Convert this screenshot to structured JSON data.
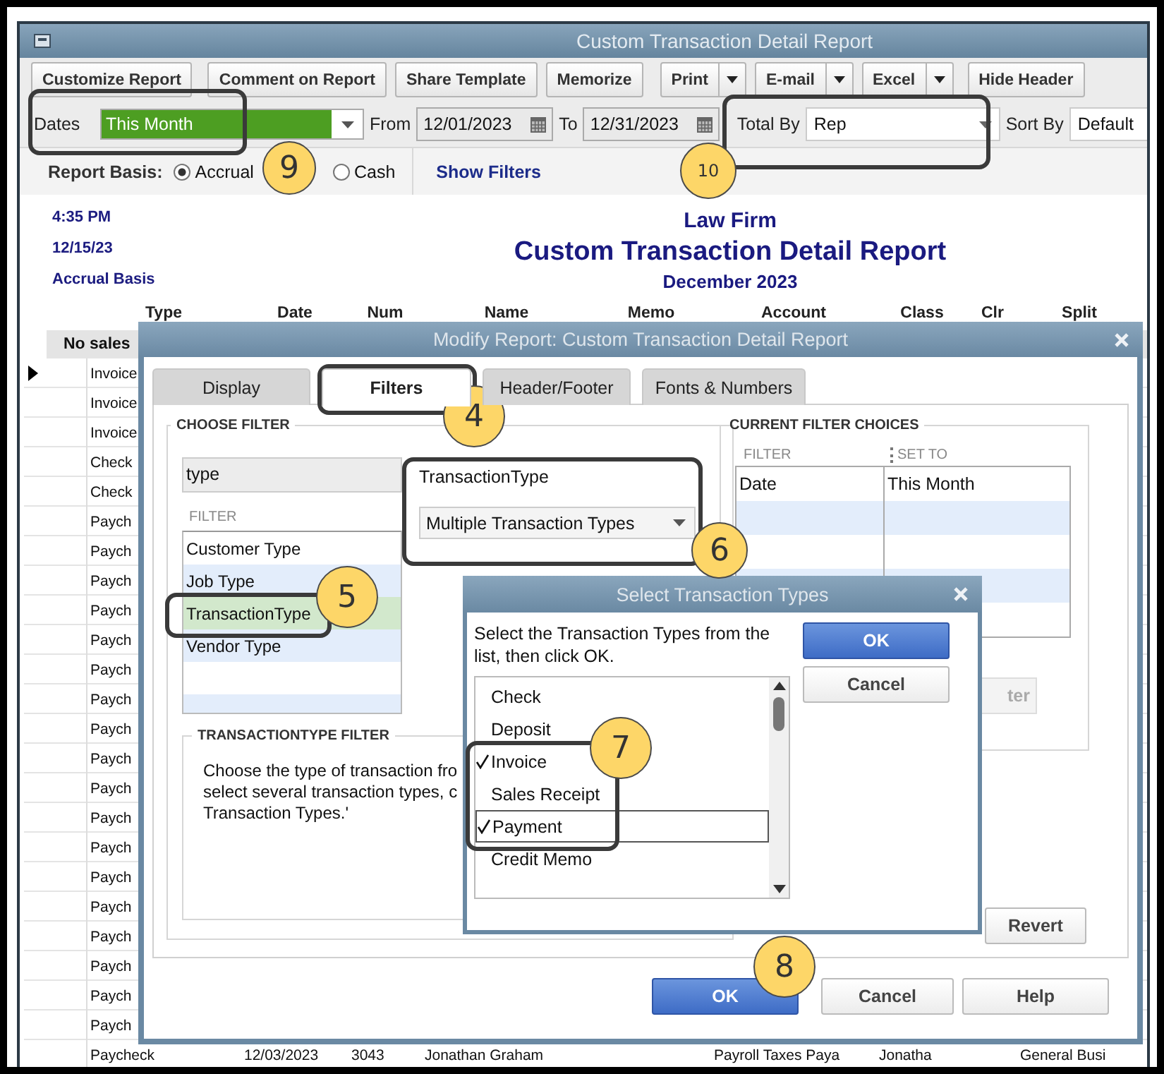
{
  "window": {
    "title": "Custom Transaction Detail Report"
  },
  "toolbar": [
    {
      "label": "Customize Report",
      "kind": "button"
    },
    {
      "label": "Comment on Report",
      "kind": "button"
    },
    {
      "label": "Share Template",
      "kind": "button"
    },
    {
      "label": "Memorize",
      "kind": "button"
    },
    {
      "label": "Print",
      "kind": "split"
    },
    {
      "label": "E-mail",
      "kind": "split"
    },
    {
      "label": "Excel",
      "kind": "split"
    },
    {
      "label": "Hide Header",
      "kind": "button"
    }
  ],
  "filter_bar": {
    "dates_label": "Dates",
    "dates_value": "This Month",
    "from_label": "From",
    "from_value": "12/01/2023",
    "to_label": "To",
    "to_value": "12/31/2023",
    "total_by_label": "Total By",
    "total_by_value": "Rep",
    "sort_by_label": "Sort By",
    "sort_by_value": "Default"
  },
  "basis": {
    "label": "Report Basis:",
    "options": [
      {
        "label": "Accrual",
        "selected": true
      },
      {
        "label": "Cash",
        "selected": false
      }
    ],
    "show_filters": "Show Filters"
  },
  "report": {
    "time": "4:35 PM",
    "date": "12/15/23",
    "basis": "Accrual Basis",
    "company": "Law Firm",
    "title": "Custom Transaction Detail Report",
    "period": "December 2023",
    "columns": [
      "Type",
      "Date",
      "Num",
      "Name",
      "Memo",
      "Account",
      "Class",
      "Clr",
      "Split"
    ],
    "group": "No sales",
    "rows": [
      {
        "cells": [
          "Invoice"
        ],
        "current": true
      },
      {
        "cells": [
          "Invoice"
        ],
        "current": false
      },
      {
        "cells": [
          "Invoice"
        ],
        "current": false
      },
      {
        "cells": [
          "Check"
        ],
        "current": false
      },
      {
        "cells": [
          "Check"
        ],
        "current": false
      },
      {
        "cells": [
          "Paych"
        ],
        "current": false
      },
      {
        "cells": [
          "Paych"
        ],
        "current": false
      },
      {
        "cells": [
          "Paych"
        ],
        "current": false
      },
      {
        "cells": [
          "Paych"
        ],
        "current": false
      },
      {
        "cells": [
          "Paych"
        ],
        "current": false
      },
      {
        "cells": [
          "Paych"
        ],
        "current": false
      },
      {
        "cells": [
          "Paych"
        ],
        "current": false
      },
      {
        "cells": [
          "Paych"
        ],
        "current": false
      },
      {
        "cells": [
          "Paych"
        ],
        "current": false
      },
      {
        "cells": [
          "Paych"
        ],
        "current": false
      },
      {
        "cells": [
          "Paych"
        ],
        "current": false
      },
      {
        "cells": [
          "Paych"
        ],
        "current": false
      },
      {
        "cells": [
          "Paych"
        ],
        "current": false
      },
      {
        "cells": [
          "Paych"
        ],
        "current": false
      },
      {
        "cells": [
          "Paych"
        ],
        "current": false
      },
      {
        "cells": [
          "Paych"
        ],
        "current": false
      },
      {
        "cells": [
          "Paych"
        ],
        "current": false
      },
      {
        "cells": [
          "Paych"
        ],
        "current": false
      },
      {
        "cells": [
          "Paycheck",
          "12/03/2023",
          "3043",
          "Jonathan Graham",
          "",
          "Payroll Taxes Paya",
          "Jonatha",
          "",
          "General Busi"
        ],
        "current": false
      }
    ]
  },
  "modify": {
    "title": "Modify Report: Custom Transaction Detail Report",
    "tabs": [
      {
        "label": "Display",
        "selected": false
      },
      {
        "label": "Filters",
        "selected": true
      },
      {
        "label": "Header/Footer",
        "selected": false
      },
      {
        "label": "Fonts & Numbers",
        "selected": false
      }
    ],
    "choose_filter": {
      "heading": "CHOOSE FILTER",
      "search": "type",
      "list_heading": "FILTER",
      "items": [
        {
          "label": "Customer Type",
          "selected": false
        },
        {
          "label": "Job Type",
          "selected": false
        },
        {
          "label": "TransactionType",
          "selected": true
        },
        {
          "label": "Vendor Type",
          "selected": false
        }
      ],
      "field_label": "TransactionType",
      "field_value": "Multiple Transaction Types"
    },
    "description": {
      "heading": "TRANSACTIONTYPE FILTER",
      "lines": [
        "Choose the type of transaction fro",
        "select several transaction types, c",
        "Transaction Types.'"
      ]
    },
    "current": {
      "heading": "CURRENT FILTER CHOICES",
      "columns": [
        "FILTER",
        "SET TO"
      ],
      "rows": [
        [
          "Date",
          "This Month"
        ]
      ],
      "remove_button": {
        "label": "ter",
        "disabled": true
      },
      "revert_button": "Revert"
    },
    "buttons": [
      {
        "label": "OK",
        "kind": "primary"
      },
      {
        "label": "Cancel",
        "kind": "normal"
      },
      {
        "label": "Help",
        "kind": "normal"
      }
    ]
  },
  "select_dialog": {
    "title": "Select Transaction Types",
    "instructions": "Select the Transaction Types from the list, then click OK.",
    "items": [
      {
        "label": "Check",
        "checked": false,
        "focused": false
      },
      {
        "label": "Deposit",
        "checked": false,
        "focused": false
      },
      {
        "label": "Invoice",
        "checked": true,
        "focused": false
      },
      {
        "label": "Sales Receipt",
        "checked": false,
        "focused": false
      },
      {
        "label": "Payment",
        "checked": true,
        "focused": true
      },
      {
        "label": "Credit Memo",
        "checked": false,
        "focused": false
      }
    ],
    "buttons": [
      {
        "label": "OK",
        "kind": "primary"
      },
      {
        "label": "Cancel",
        "kind": "normal"
      }
    ]
  },
  "annotations": [
    {
      "number": "9"
    },
    {
      "number": "10"
    },
    {
      "number": "4"
    },
    {
      "number": "5"
    },
    {
      "number": "6"
    },
    {
      "number": "7"
    },
    {
      "number": "8"
    }
  ]
}
